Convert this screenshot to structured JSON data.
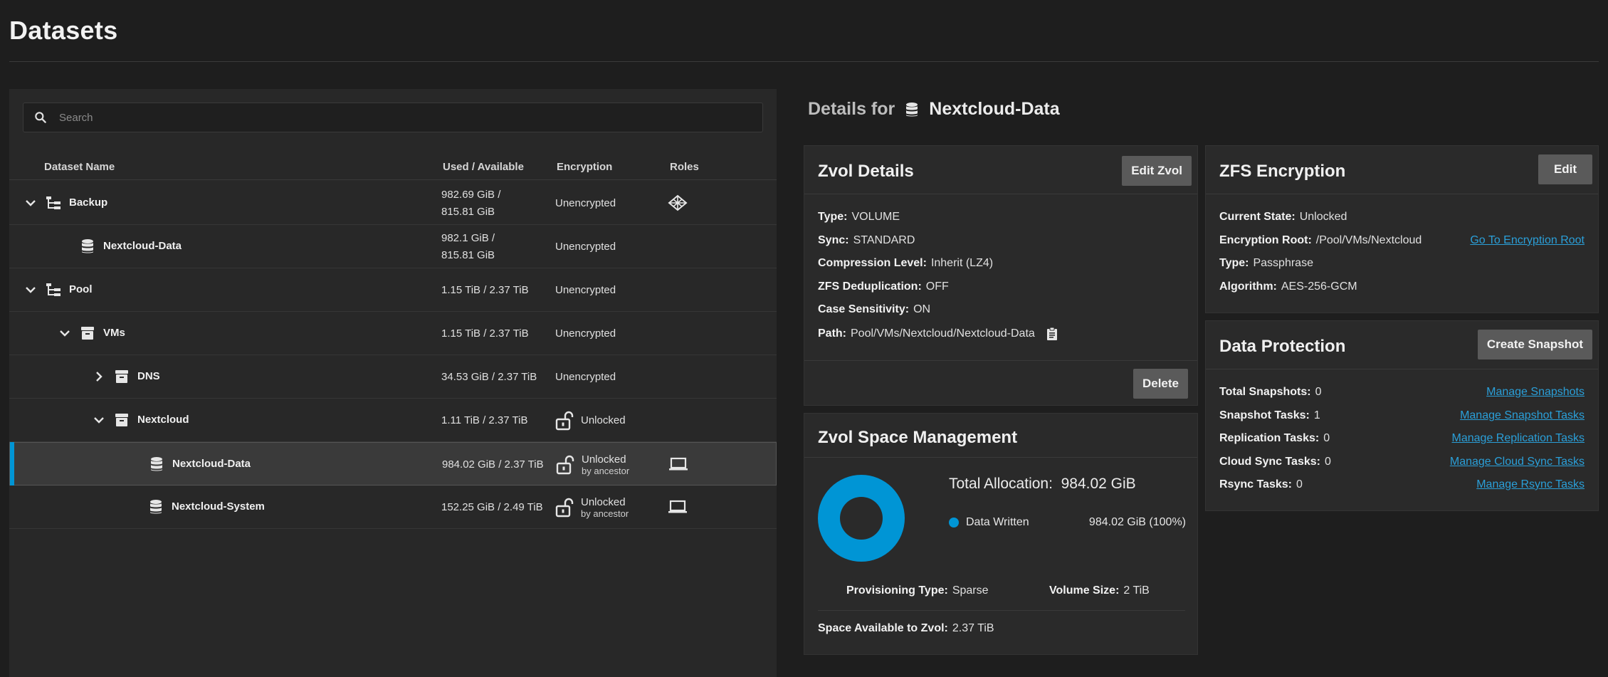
{
  "page": {
    "title": "Datasets"
  },
  "search": {
    "placeholder": "Search"
  },
  "columns": {
    "name": "Dataset Name",
    "used": "Used / Available",
    "encryption": "Encryption",
    "roles": "Roles"
  },
  "rows": [
    {
      "name": "Backup",
      "used_line1": "982.69 GiB /",
      "used_line2": "815.81 GiB",
      "encryption": "Unencrypted",
      "icon": "pool-tree-icon",
      "chevron": "down"
    },
    {
      "name": "Nextcloud-Data",
      "used_line1": "982.1 GiB /",
      "used_line2": "815.81 GiB",
      "encryption": "Unencrypted",
      "icon": "database-icon"
    },
    {
      "name": "Pool",
      "used": "1.15 TiB / 2.37 TiB",
      "encryption": "Unencrypted",
      "icon": "pool-tree-icon",
      "chevron": "down"
    },
    {
      "name": "VMs",
      "used": "1.15 TiB / 2.37 TiB",
      "encryption": "Unencrypted",
      "icon": "archive-icon",
      "chevron": "down"
    },
    {
      "name": "DNS",
      "used": "34.53 GiB / 2.37 TiB",
      "encryption": "Unencrypted",
      "icon": "archive-icon",
      "chevron": "right"
    },
    {
      "name": "Nextcloud",
      "used": "1.11 TiB / 2.37 TiB",
      "encryption": "Unlocked",
      "icon": "archive-icon",
      "chevron": "down"
    },
    {
      "name": "Nextcloud-Data",
      "used": "984.02 GiB / 2.37 TiB",
      "encryption": "Unlocked",
      "encryption_sub": "by ancestor",
      "icon": "database-icon",
      "selected": true
    },
    {
      "name": "Nextcloud-System",
      "used": "152.25 GiB / 2.49 TiB",
      "encryption": "Unlocked",
      "encryption_sub": "by ancestor",
      "icon": "database-icon"
    }
  ],
  "details": {
    "prefix": "Details for",
    "name": "Nextcloud-Data"
  },
  "zvol": {
    "title": "Zvol Details",
    "edit_label": "Edit Zvol",
    "delete_label": "Delete",
    "fields": [
      {
        "label": "Type:",
        "value": "VOLUME"
      },
      {
        "label": "Sync:",
        "value": "STANDARD"
      },
      {
        "label": "Compression Level:",
        "value": "Inherit (LZ4)"
      },
      {
        "label": "ZFS Deduplication:",
        "value": "OFF"
      },
      {
        "label": "Case Sensitivity:",
        "value": "ON"
      },
      {
        "label": "Path:",
        "value": "Pool/VMs/Nextcloud/Nextcloud-Data"
      }
    ]
  },
  "encryption_card": {
    "title": "ZFS Encryption",
    "edit_label": "Edit",
    "current_state_label": "Current State:",
    "current_state": "Unlocked",
    "root_label": "Encryption Root:",
    "root": "/Pool/VMs/Nextcloud",
    "root_link": "Go To Encryption Root",
    "type_label": "Type:",
    "type": "Passphrase",
    "algorithm_label": "Algorithm:",
    "algorithm": "AES-256-GCM"
  },
  "protection": {
    "title": "Data Protection",
    "snapshot_button": "Create Snapshot",
    "items": [
      {
        "label": "Total Snapshots:",
        "value": "0",
        "link": "Manage Snapshots"
      },
      {
        "label": "Snapshot Tasks:",
        "value": "1",
        "link": "Manage Snapshot Tasks"
      },
      {
        "label": "Replication Tasks:",
        "value": "0",
        "link": "Manage Replication Tasks"
      },
      {
        "label": "Cloud Sync Tasks:",
        "value": "0",
        "link": "Manage Cloud Sync Tasks"
      },
      {
        "label": "Rsync Tasks:",
        "value": "0",
        "link": "Manage Rsync Tasks"
      }
    ]
  },
  "space": {
    "title": "Zvol Space Management",
    "total_label": "Total Allocation:",
    "total": "984.02 GiB",
    "legend_label": "Data Written",
    "legend_value": "984.02 GiB (100%)",
    "written_fraction": 1.0,
    "provisioning_label": "Provisioning Type:",
    "provisioning": "Sparse",
    "volsize_label": "Volume Size:",
    "volsize": "2 TiB",
    "available_label": "Space Available to Zvol:",
    "available": "2.37 TiB"
  },
  "colors": {
    "accent": "#0095d5",
    "link": "#2a9fd8"
  }
}
